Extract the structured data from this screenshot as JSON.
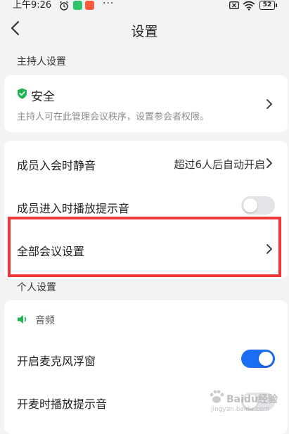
{
  "status_bar": {
    "time": "上午9:26",
    "battery": "52",
    "overflow": "···"
  },
  "header": {
    "title": "设置"
  },
  "host_section": {
    "label": "主持人设置",
    "security": {
      "title": "安全",
      "description": "主持人可在此管理会议秩序，设置参会者权限。"
    }
  },
  "meeting_card": {
    "mute_on_join": {
      "label": "成员入会时静音",
      "value": "超过6人后自动开启"
    },
    "join_sound": {
      "label": "成员进入时播放提示音",
      "enabled": false
    },
    "all_settings": {
      "label": "全部会议设置"
    }
  },
  "personal_section": {
    "label": "个人设置",
    "audio": {
      "label": "音频"
    },
    "mic_float": {
      "label": "开启麦克风浮窗",
      "enabled": true
    },
    "unmute_sound": {
      "label": "开麦时播放提示音",
      "enabled": false
    }
  },
  "watermark": {
    "text": "Baidu经验",
    "url": "jingyan.baidu.com"
  },
  "colors": {
    "accent": "#1b6ef3",
    "security_green": "#21b352",
    "highlight_red": "#f0383b",
    "background": "#f2f3f5"
  }
}
